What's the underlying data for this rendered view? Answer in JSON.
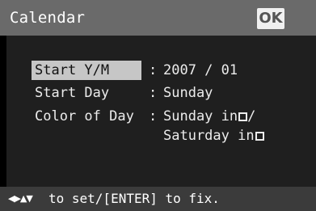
{
  "header": {
    "title": "Calendar",
    "ok_label": "OK"
  },
  "settings": [
    {
      "label": "Start Y/M",
      "value": "2007 / 01",
      "selected": true
    },
    {
      "label": "Start Day",
      "value": "Sunday"
    },
    {
      "label": "Color of Day",
      "value_line1": "Sunday in",
      "value_line1_suffix": "/",
      "value_line2": "Saturday in"
    }
  ],
  "separator": ":",
  "footer": {
    "arrows": "◀▶▲▼",
    "hint": "to set/[ENTER] to fix."
  }
}
